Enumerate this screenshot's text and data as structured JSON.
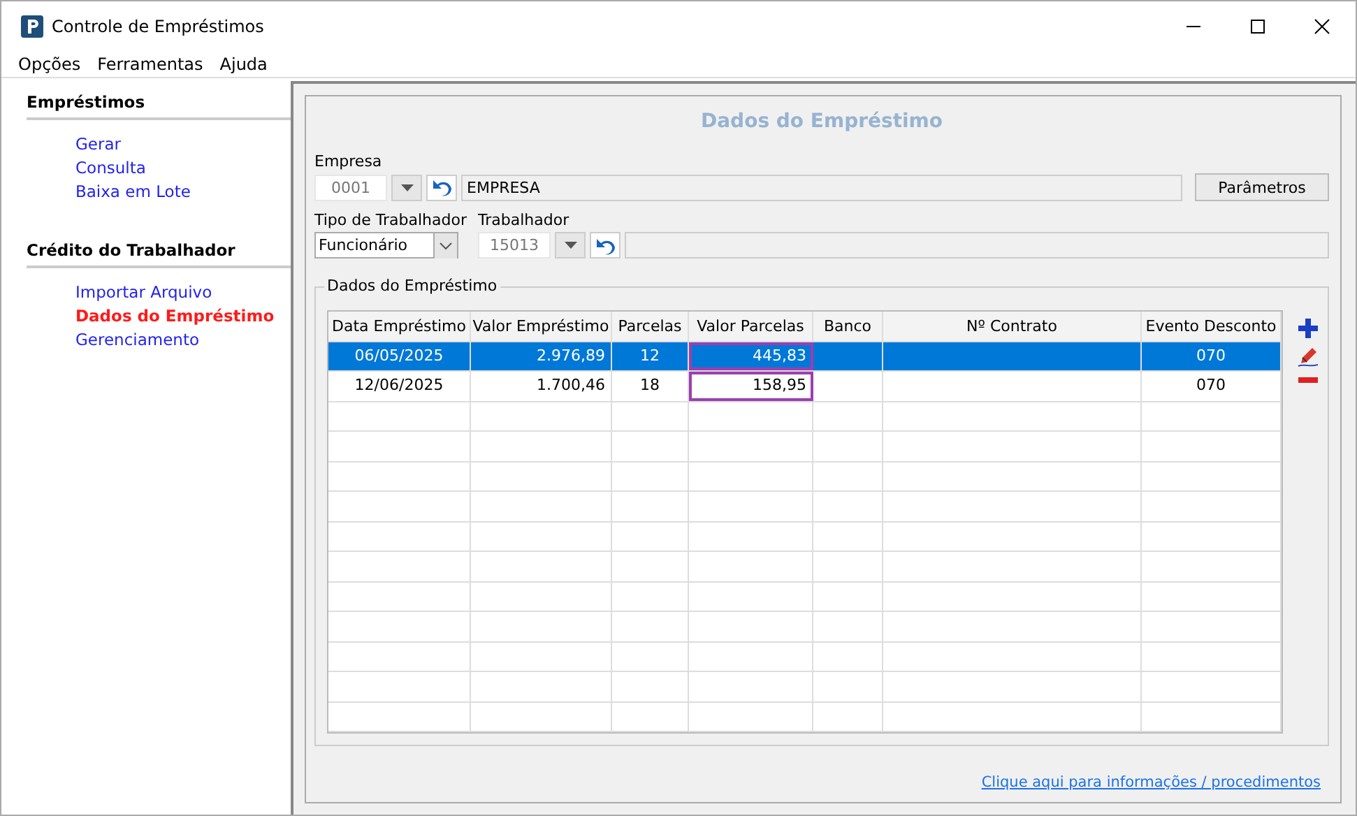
{
  "window": {
    "title": "Controle de Empréstimos"
  },
  "menu": [
    "Opções",
    "Ferramentas",
    "Ajuda"
  ],
  "sidebar": {
    "sections": [
      {
        "title": "Empréstimos",
        "items": [
          {
            "label": "Gerar",
            "selected": false
          },
          {
            "label": "Consulta",
            "selected": false
          },
          {
            "label": "Baixa em Lote",
            "selected": false
          }
        ]
      },
      {
        "title": "Crédito do Trabalhador",
        "items": [
          {
            "label": "Importar Arquivo",
            "selected": false
          },
          {
            "label": "Dados do Empréstimo",
            "selected": true
          },
          {
            "label": "Gerenciamento",
            "selected": false
          }
        ]
      }
    ]
  },
  "panel": {
    "title": "Dados do Empréstimo",
    "empresa": {
      "label": "Empresa",
      "code": "0001",
      "name": "EMPRESA"
    },
    "parametros_button": "Parâmetros",
    "tipo_trabalhador": {
      "label": "Tipo de Trabalhador",
      "value": "Funcionário"
    },
    "trabalhador": {
      "label": "Trabalhador",
      "code": "15013"
    },
    "group_title": "Dados do Empréstimo",
    "table": {
      "columns": [
        "Data Empréstimo",
        "Valor Empréstimo",
        "Parcelas",
        "Valor Parcelas",
        "Banco",
        "Nº Contrato",
        "Evento Desconto"
      ],
      "rows": [
        {
          "selected": true,
          "valor_parcelas_highlighted": true,
          "cells": [
            "06/05/2025",
            "2.976,89",
            "12",
            "445,83",
            "",
            "",
            "070"
          ]
        },
        {
          "selected": false,
          "valor_parcelas_highlighted": true,
          "cells": [
            "12/06/2025",
            "1.700,46",
            "18",
            "158,95",
            "",
            "",
            "070"
          ]
        }
      ]
    },
    "link": "Clique aqui para informações / procedimentos"
  }
}
